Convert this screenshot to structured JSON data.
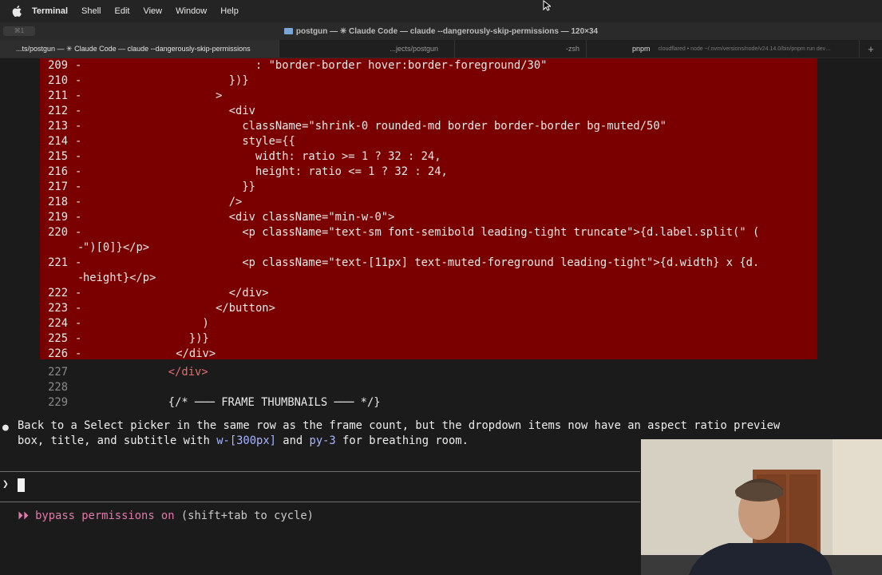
{
  "menubar": {
    "app": "Terminal",
    "items": [
      "Shell",
      "Edit",
      "View",
      "Window",
      "Help"
    ]
  },
  "window": {
    "title": "postgun — ✳ Claude Code — claude --dangerously-skip-permissions — 120×34",
    "left_pill": "⌘1"
  },
  "tabs": [
    {
      "name": "...ts/postgun — ✳ Claude Code — claude --dangerously-skip-permissions",
      "sub": "",
      "active": true
    },
    {
      "name": "...jects/postgun",
      "sub": "",
      "active": false
    },
    {
      "name": "-zsh",
      "sub": "",
      "active": false
    },
    {
      "name": "pnpm",
      "sub": "cloudflared • node ~/.nvm/versions/node/v24.14.0/bin/pnpm run dev…",
      "active": false
    }
  ],
  "tab_plus": "+",
  "code_lines": [
    {
      "num": "209",
      "text": "                          : \"border-border hover:border-foreground/30\""
    },
    {
      "num": "210",
      "text": "                      })}"
    },
    {
      "num": "211",
      "text": "                    >"
    },
    {
      "num": "212",
      "text": "                      <div"
    },
    {
      "num": "213",
      "text": "                        className=\"shrink-0 rounded-md border border-border bg-muted/50\""
    },
    {
      "num": "214",
      "text": "                        style={{"
    },
    {
      "num": "215",
      "text": "                          width: ratio >= 1 ? 32 : 24,"
    },
    {
      "num": "216",
      "text": "                          height: ratio <= 1 ? 32 : 24,"
    },
    {
      "num": "217",
      "text": "                        }}"
    },
    {
      "num": "218",
      "text": "                      />"
    },
    {
      "num": "219",
      "text": "                      <div className=\"min-w-0\">"
    },
    {
      "num": "220",
      "text": "                        <p className=\"text-sm font-semibold leading-tight truncate\">{d.label.split(\" (",
      "cont": "\")[0]}</p>"
    },
    {
      "num": "221",
      "text": "                        <p className=\"text-[11px] text-muted-foreground leading-tight\">{d.width} x {d.",
      "cont": "height}</p>"
    },
    {
      "num": "222",
      "text": "                      </div>"
    },
    {
      "num": "223",
      "text": "                    </button>"
    },
    {
      "num": "224",
      "text": "                  )"
    },
    {
      "num": "225",
      "text": "                })}"
    },
    {
      "num": "226",
      "text": "              </div>"
    }
  ],
  "normal_lines": [
    {
      "num": "227",
      "indent": "            ",
      "text": "</div>"
    },
    {
      "num": "228",
      "indent": "",
      "text": ""
    },
    {
      "num": "229",
      "indent": "            ",
      "text": "{/* ─── FRAME THUMBNAILS ─── */}"
    }
  ],
  "message": {
    "bullet": "●",
    "line1": "Back to a Select picker in the same row as the frame count, but the dropdown items now have an aspect ratio preview",
    "line2_a": "box, title, and subtitle with ",
    "line2_code1": "w-[300px]",
    "line2_b": " and ",
    "line2_code2": "py-3",
    "line2_c": " for breathing room."
  },
  "prompt": {
    "char": "❯"
  },
  "status": {
    "arrows": "⏵⏵",
    "text": "bypass permissions on",
    "hint": " (shift+tab to cycle)"
  },
  "colors": {
    "deleted_bg": "#7a0000",
    "accent_pink": "#e07aa9",
    "inline_code": "#a7b4ff"
  }
}
